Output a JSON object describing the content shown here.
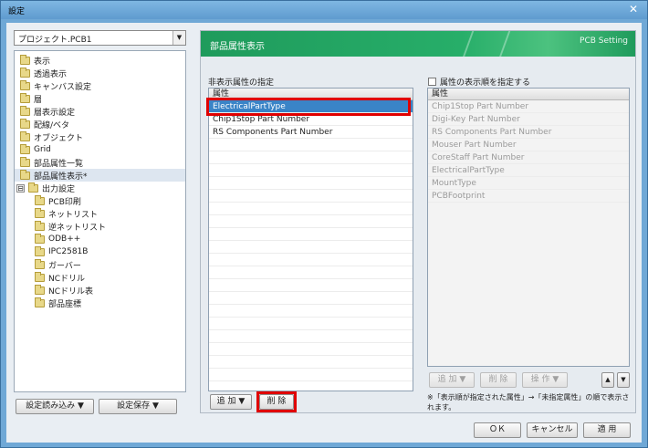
{
  "window": {
    "title": "設定",
    "close_glyph": "✕"
  },
  "project_select": {
    "value": "プロジェクト.PCB1",
    "arrow": "▼"
  },
  "tree": {
    "items": [
      {
        "label": "表示"
      },
      {
        "label": "透過表示"
      },
      {
        "label": "キャンバス設定"
      },
      {
        "label": "層"
      },
      {
        "label": "層表示設定"
      },
      {
        "label": "配線/ベタ"
      },
      {
        "label": "オブジェクト"
      },
      {
        "label": "Grid"
      },
      {
        "label": "部品属性一覧"
      },
      {
        "label": "部品属性表示*"
      },
      {
        "label": "出力設定",
        "expander": "⊟"
      },
      {
        "label": "PCB印刷"
      },
      {
        "label": "ネットリスト"
      },
      {
        "label": "逆ネットリスト"
      },
      {
        "label": "ODB++"
      },
      {
        "label": "IPC2581B"
      },
      {
        "label": "ガーバー"
      },
      {
        "label": "NCドリル"
      },
      {
        "label": "NCドリル表"
      },
      {
        "label": "部品座標"
      }
    ]
  },
  "left_buttons": {
    "load": "設定読み込み ▼",
    "save": "設定保存 ▼"
  },
  "banner": {
    "title": "部品属性表示",
    "subtitle": "PCB Setting"
  },
  "hidden_attrs": {
    "label": "非表示属性の指定",
    "header": "属性",
    "rows": [
      "ElectricalPartType",
      "Chip1Stop Part Number",
      "RS Components Part Number"
    ]
  },
  "display_order": {
    "checkbox_label": "属性の表示順を指定する",
    "checked": false,
    "header": "属性",
    "rows": [
      "Chip1Stop Part Number",
      "Digi-Key Part Number",
      "RS Components Part Number",
      "Mouser Part Number",
      "CoreStaff Part Number",
      "ElectricalPartType",
      "MountType",
      "PCBFootprint"
    ]
  },
  "panel_buttons": {
    "add": "追 加 ▼",
    "delete": "削 除",
    "add_disabled": "追 加 ▼",
    "delete_disabled": "削 除",
    "operate_disabled": "操 作 ▼",
    "up": "▲",
    "down": "▼"
  },
  "note": "※「表示順が指定された属性」→「未指定属性」の順で表示されます。",
  "footer": {
    "ok": "ＯＫ",
    "cancel": "キャンセル",
    "apply": "適 用"
  },
  "colors": {
    "accent": "#3a84c7",
    "banner": "#1f9b5c",
    "highlight": "#e00000"
  }
}
